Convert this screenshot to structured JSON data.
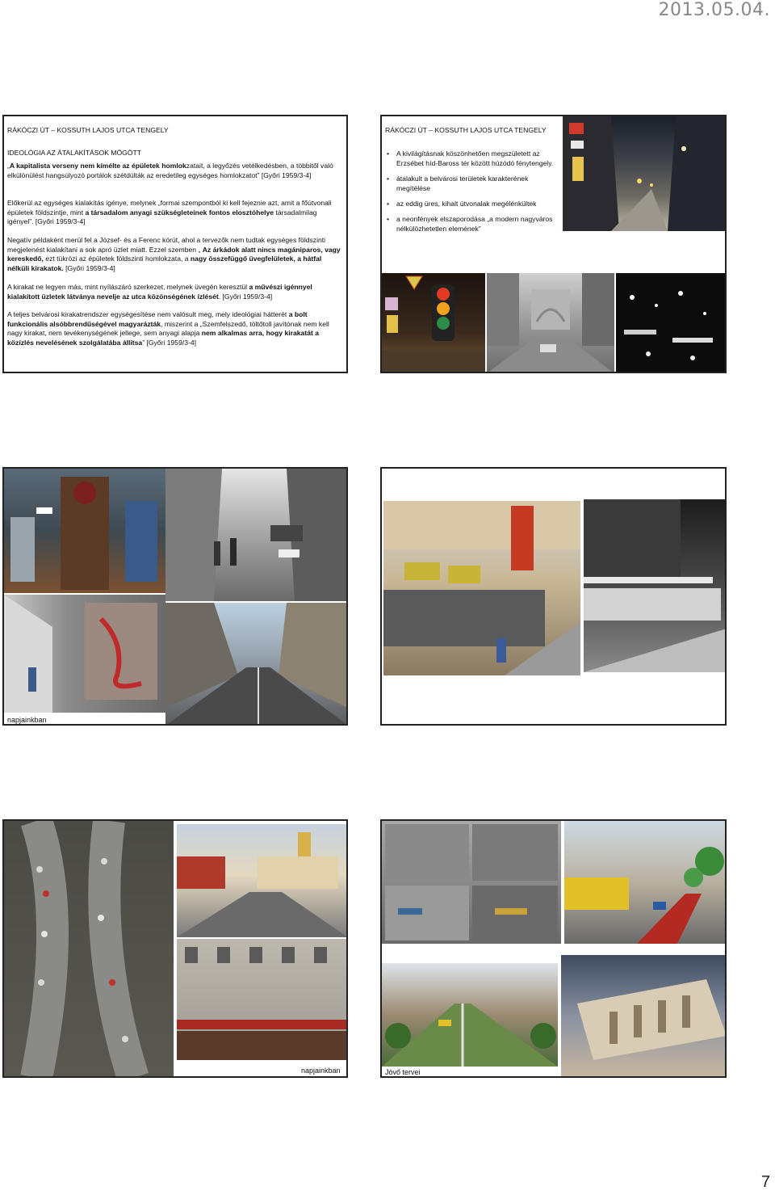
{
  "header": {
    "date": "2013.05.04."
  },
  "footer": {
    "page_number": "7"
  },
  "slide1": {
    "title": "RÁKÓCZI ÚT – KOSSUTH LAJOS UTCA TENGELY",
    "subtitle": "IDEOLÓGIA AZ ÁTALAKÍTÁSOK MÖGÖTT",
    "p1": [
      {
        "t": "„",
        "b": false
      },
      {
        "t": "A kapitalista verseny nem kímélte az épületek homlok",
        "b": true
      },
      {
        "t": "zatait, a legyőzés vetélkedésben, a többitől való elkülönülést hangsúlyozó portálok szétdúlták az eredetileg egységes homlokzatot” [Győri 1959/3-4]",
        "b": false
      }
    ],
    "p2": [
      {
        "t": "Előkerül az egységes kialakítás igénye, melynek „formai szempontból ki kell fejeznie azt, amit a főútvonali épületek földszintje, mint ",
        "b": false
      },
      {
        "t": "a társadalom anyagi szükségleteinek fontos elosztóhelye",
        "b": true
      },
      {
        "t": " társadalmilag igényel”. [Győri 1959/3-4]",
        "b": false
      }
    ],
    "p3": [
      {
        "t": "Negatív példaként merül fel a József- és a Ferenc körút, ahol a tervezők nem tudtak egységes földszinti megjelenést kialakítani a sok apró üzlet miatt. Ezzel szemben „ ",
        "b": false
      },
      {
        "t": "Az árkádok alatt nincs magániparos, vagy kereskedő,",
        "b": true
      },
      {
        "t": " ezt tükrözi az épületek földszinti homlokzata, a ",
        "b": false
      },
      {
        "t": "nagy összefüggő üvegfelületek, a hátfal nélküli kirakatok.",
        "b": true
      },
      {
        "t": " [Győri 1959/3-4]",
        "b": false
      }
    ],
    "p4": [
      {
        "t": "A kirakat ne legyen más, mint nyílászáró szerkezet, melynek üvegén keresztül ",
        "b": false
      },
      {
        "t": "a művészi igénnyel kialakított üzletek látványa nevelje az utca közönségének ízlését",
        "b": true
      },
      {
        "t": ". [Győri 1959/3-4]",
        "b": false
      }
    ],
    "p5": [
      {
        "t": "A teljes belvárosi kirakatrendszer egységesítése nem valósult meg, mely ideológiai hátterét ",
        "b": false
      },
      {
        "t": "a bolt funkcionális alsóbbrendűségével magyarázták",
        "b": true
      },
      {
        "t": ", miszerint a „Szemfelszedő, töltőtoll javítónak nem kell nagy kirakat, nem tevékenységének jellege, sem anyagi alapja ",
        "b": false
      },
      {
        "t": "nem alkalmas arra, hogy kirakatát a közízlés nevelésének szolgálatába állítsa",
        "b": true
      },
      {
        "t": "” [Győri 1959/3-4]",
        "b": false
      }
    ]
  },
  "slide2": {
    "title": "RÁKÓCZI ÚT – KOSSUTH LAJOS UTCA TENGELY",
    "bullets": [
      "A kivilágításnak köszönhetően megszületett az Erzsébet híd-Baross tér között húzódó fénytengely.",
      "átalakult a belvárosi területek karakterének megítélése",
      "az eddig üres, kihalt útvonalak megélénkültek",
      "a neonfények elszaporodása „a modern nagyváros nélkülözhetetlen elemének”"
    ]
  },
  "slide3": {
    "caption": "napjainkban"
  },
  "slide5": {
    "caption": "napjainkban"
  },
  "slide6": {
    "caption": "Jövő tervei"
  }
}
